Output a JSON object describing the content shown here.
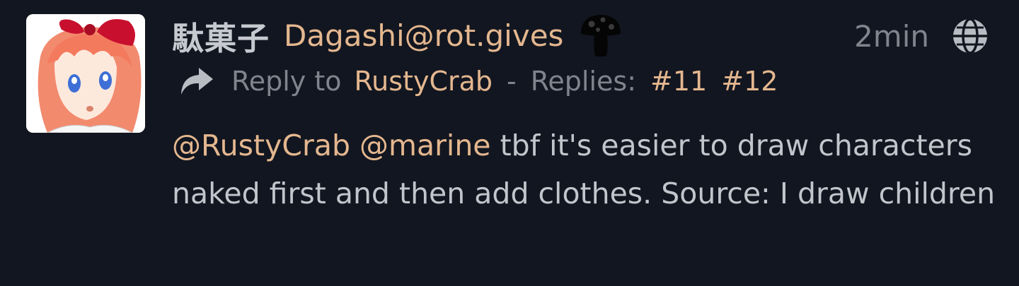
{
  "post": {
    "author": {
      "display_name": "駄菓子",
      "handle": "Dagashi@rot.gives",
      "emoji": "mushroom-emoji",
      "avatar": "anime-girl-avatar"
    },
    "time": "2min",
    "visibility_icon": "globe-icon",
    "reply_icon": "reply-arrow-icon",
    "reply_to_label": "Reply to",
    "reply_to_user": "RustyCrab",
    "separator": "-",
    "replies_label": "Replies:",
    "replies": [
      "#11",
      "#12"
    ],
    "content": {
      "mention1": "@RustyCrab",
      "mention2": "@marine",
      "text": "tbf it's easier to draw characters naked first and then add clothes. Source: I draw children"
    }
  },
  "colors": {
    "background": "#121620",
    "accent": "#e4b78f",
    "muted": "#80848d",
    "text": "#c2c5cb"
  }
}
